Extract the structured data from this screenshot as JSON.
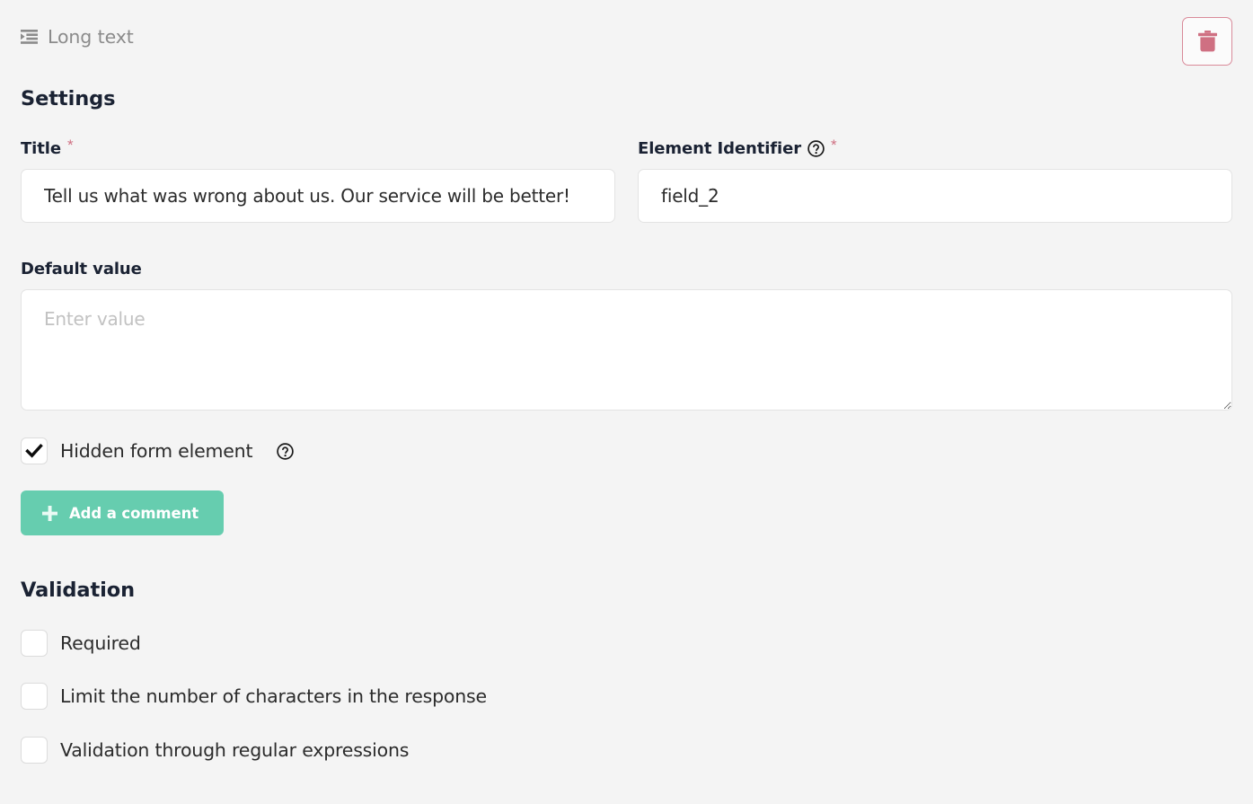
{
  "header": {
    "element_type_icon": "text-indent-icon",
    "element_type_label": "Long text",
    "delete_button_icon": "trash-icon",
    "delete_button_title": "Delete"
  },
  "settings": {
    "heading": "Settings",
    "title_field": {
      "label": "Title",
      "required_marker": "*",
      "value": "Tell us what was wrong about us. Our service will be better!",
      "placeholder": ""
    },
    "identifier_field": {
      "label": "Element Identifier",
      "help_icon": "question-circle-icon",
      "required_marker": "*",
      "value": "field_2",
      "placeholder": ""
    },
    "default_value_field": {
      "label": "Default value",
      "value": "",
      "placeholder": "Enter value"
    },
    "hidden_form_element": {
      "label": "Hidden form element",
      "checked": true,
      "help_icon": "question-circle-icon"
    },
    "add_comment_button": {
      "label": "Add a comment",
      "icon": "plus-icon"
    }
  },
  "validation": {
    "heading": "Validation",
    "options": [
      {
        "label": "Required",
        "checked": false
      },
      {
        "label": "Limit the number of characters in the response",
        "checked": false
      },
      {
        "label": "Validation through regular expressions",
        "checked": false
      }
    ]
  },
  "colors": {
    "page_background": "#f4f4f4",
    "accent_green": "#66cdaf",
    "danger_red": "#cf7082",
    "required_asterisk": "#cf7082",
    "text_primary": "#1a2233",
    "text_muted": "#8b8b8b",
    "input_border": "#e3e3e3"
  }
}
